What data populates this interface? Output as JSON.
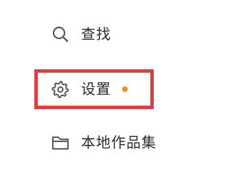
{
  "menu": {
    "items": [
      {
        "label": "查找",
        "icon": "search-icon"
      },
      {
        "label": "设置",
        "icon": "gear-icon",
        "badge": "notification-dot"
      },
      {
        "label": "本地作品集",
        "icon": "folder-icon"
      }
    ]
  },
  "colors": {
    "icon": "#555555",
    "text": "#2b2b2b",
    "badge_dot": "#f08a1c",
    "highlight": "#e23a3e"
  }
}
